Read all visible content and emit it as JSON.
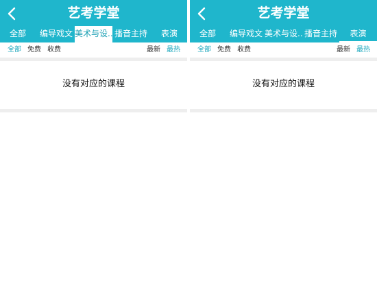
{
  "colors": {
    "header_bg": "#1fb6cc",
    "accent": "#1aa7bd",
    "separator": "#eeeeee"
  },
  "screens": [
    {
      "title": "艺考学堂",
      "back_icon": "chevron-left-icon",
      "tabs": [
        "全部",
        "编导戏文",
        "美术与设...",
        "播音主持",
        "表演"
      ],
      "active_tab": "美术与设...",
      "filters_left": [
        "全部",
        "免费",
        "收费"
      ],
      "active_filter_left": "全部",
      "filters_right": [
        "最新",
        "最热"
      ],
      "active_filter_right": "最热",
      "empty_message": "没有对应的课程"
    },
    {
      "title": "艺考学堂",
      "back_icon": "chevron-left-icon",
      "tabs": [
        "全部",
        "编导戏文",
        "美术与设...",
        "播音主持",
        "表演"
      ],
      "active_tab": "表演",
      "filters_left": [
        "全部",
        "免费",
        "收费"
      ],
      "active_filter_left": "全部",
      "filters_right": [
        "最新",
        "最热"
      ],
      "active_filter_right": "最热",
      "empty_message": "没有对应的课程"
    }
  ]
}
